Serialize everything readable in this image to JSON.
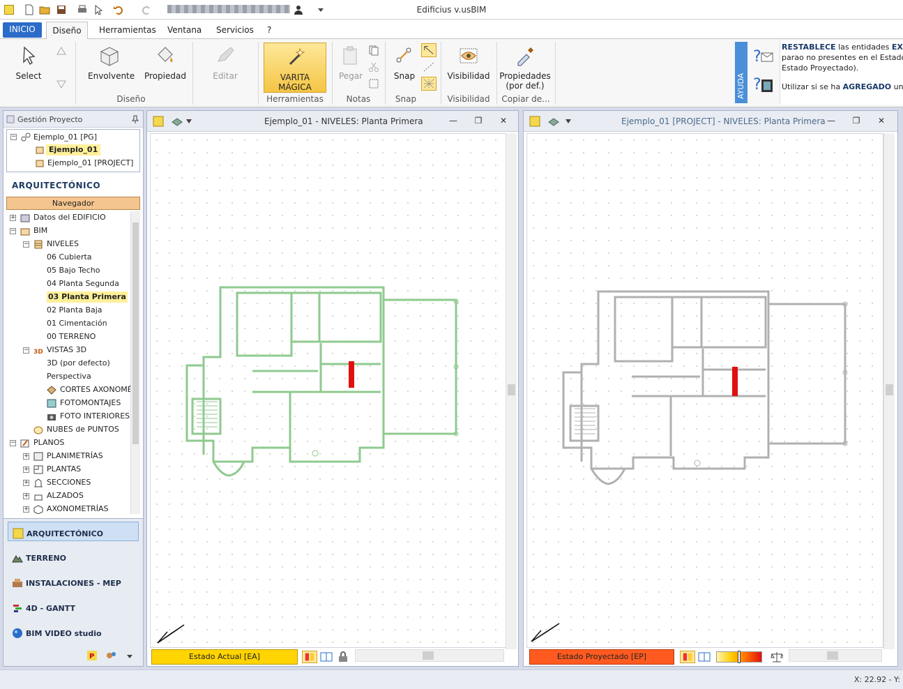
{
  "window": {
    "title": "Edificius v.usBIM"
  },
  "ribbon_tabs": [
    "INICIO",
    "Diseño",
    "Herramientas",
    "Ventana",
    "Servicios",
    "?"
  ],
  "ribbon": {
    "buttons": {
      "select": "Select",
      "envolvente": "Envolvente",
      "propiedad": "Propiedad",
      "editar": "Editar",
      "varita1": "VARITA",
      "varita2": "MÁGICA",
      "pegar": "Pegar",
      "snap": "Snap",
      "visibilidad": "Visibilidad",
      "propiedades1": "Propiedades",
      "propiedades2": "(por def.)"
    },
    "groups": {
      "diseno": "Diseño",
      "herramientas": "Herramientas",
      "notas": "Notas",
      "snap": "Snap",
      "visibilidad": "Visibilidad",
      "copiar": "Copiar de..."
    },
    "ayuda": "AYUDA",
    "help": {
      "l1_b": "RESTABLECE",
      "l1": " las entidades ",
      "l1_b2": "EXIST",
      "l2": "parao no presentes en el Estado",
      "l3": "Estado Proyectado).",
      "l4": "Utilizar si se ha ",
      "l4_b": "AGREGADO",
      "l4_end": " una nu"
    }
  },
  "left_panel": {
    "header": "Gestión Proyecto",
    "project_tree": [
      "Ejemplo_01 [PG]",
      "Ejemplo_01",
      "Ejemplo_01 [PROJECT]"
    ],
    "section_title": "ARQUITECTÓNICO",
    "navigator_label": "Navegador",
    "nav_items": {
      "datos": "Datos del EDIFICIO",
      "bim": "BIM",
      "niveles": "NIVELES",
      "n06": "06 Cubierta",
      "n05": "05 Bajo Techo",
      "n04": "04 Planta Segunda",
      "n03": "03 Planta Primera",
      "n02": "02 Planta Baja",
      "n01": "01 Cimentación",
      "n00": "00 TERRENO",
      "vistas3d": "VISTAS 3D",
      "v3d": "3D (por defecto)",
      "persp": "Perspectiva",
      "cortes": "CORTES AXONOMÉ",
      "foto": "FOTOMONTAJES",
      "interiores": "FOTO INTERIORES",
      "nubes": "NUBES de PUNTOS",
      "planos": "PLANOS",
      "planimetrias": "PLANIMETRÍAS",
      "plantas": "PLANTAS",
      "secciones": "SECCIONES",
      "alzados": "ALZADOS",
      "axonometrias": "AXONOMETRÍAS"
    },
    "modules": [
      "ARQUITECTÓNICO",
      "TERRENO",
      "INSTALACIONES - MEP",
      "4D - GANTT",
      "BIM VIDEO studio"
    ]
  },
  "viewports": {
    "left": {
      "title": "Ejemplo_01 -  NIVELES: Planta Primera",
      "status": "Estado Actual  [EA]",
      "status_color": "#ffd400",
      "plan_color": "#8fca8f"
    },
    "right": {
      "title": "Ejemplo_01 [PROJECT] -  NIVELES: Planta Primera",
      "status": "Estado Proyectado  [EP]",
      "status_color": "#ff5a1f",
      "plan_color": "#b0b0b0"
    }
  },
  "statusbar": {
    "coords": "X: 22.92 - Y:"
  }
}
